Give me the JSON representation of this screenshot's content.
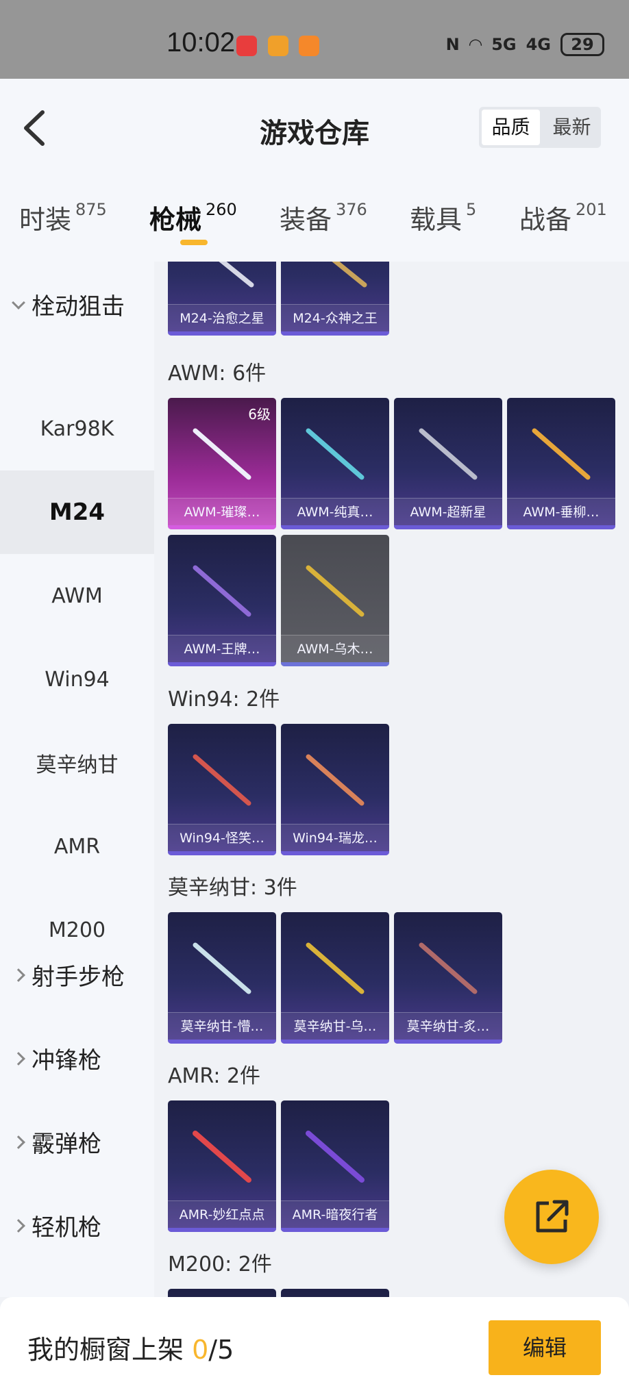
{
  "status_bar": {
    "time": "10:02",
    "signal1": "5G",
    "signal2": "4G",
    "battery": "29"
  },
  "header": {
    "title": "游戏仓库",
    "sort_options": [
      "品质",
      "最新"
    ]
  },
  "tabs": [
    {
      "label": "时装",
      "count": "875"
    },
    {
      "label": "枪械",
      "count": "260"
    },
    {
      "label": "装备",
      "count": "376"
    },
    {
      "label": "载具",
      "count": "5"
    },
    {
      "label": "战备",
      "count": "201"
    }
  ],
  "sidebar": {
    "group_open": "栓动狙击",
    "items": [
      "Kar98K",
      "M24",
      "AWM",
      "Win94",
      "莫辛纳甘",
      "AMR",
      "M200"
    ],
    "active_item": "M24",
    "groups_closed": [
      "射手步枪",
      "冲锋枪",
      "霰弹枪",
      "轻机枪"
    ]
  },
  "sections": {
    "m24": {
      "items": [
        "M24-治愈之星",
        "M24-众神之王"
      ]
    },
    "awm": {
      "heading": "AWM: 6件",
      "items": [
        "AWM-璀璨…",
        "AWM-纯真…",
        "AWM-超新星",
        "AWM-垂柳…",
        "AWM-王牌…",
        "AWM-乌木…"
      ],
      "level_badge": "6级"
    },
    "win94": {
      "heading": "Win94: 2件",
      "items": [
        "Win94-怪笑…",
        "Win94-瑞龙…"
      ]
    },
    "mosin": {
      "heading": "莫辛纳甘: 3件",
      "items": [
        "莫辛纳甘-懵…",
        "莫辛纳甘-乌…",
        "莫辛纳甘-炙…"
      ]
    },
    "amr": {
      "heading": "AMR: 2件",
      "items": [
        "AMR-妙红点点",
        "AMR-暗夜行者"
      ]
    },
    "m200": {
      "heading": "M200: 2件"
    }
  },
  "bottom_bar": {
    "label": "我的橱窗上架 ",
    "count": "0",
    "total": "/5",
    "edit_label": "编辑"
  },
  "colors": {
    "accent": "#f8b62d",
    "card_blue": "#2b2d63",
    "card_purple": "#9a2b96"
  }
}
